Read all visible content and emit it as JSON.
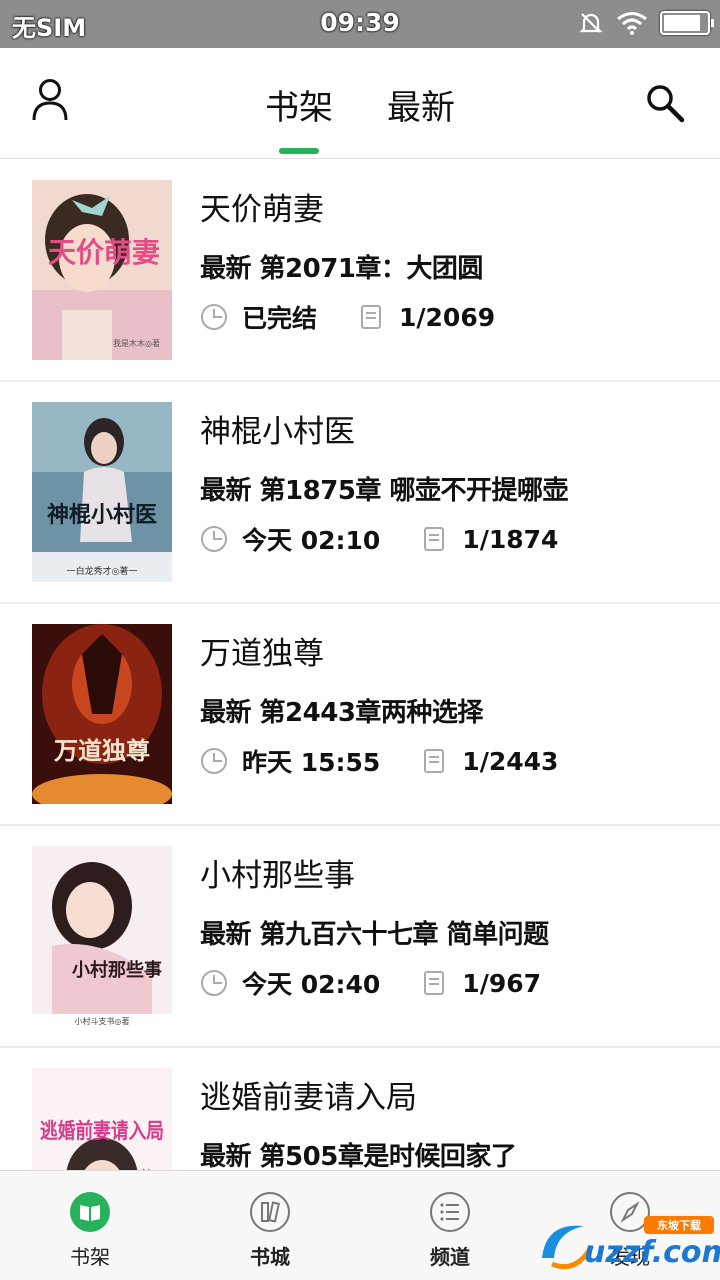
{
  "status_bar": {
    "carrier": "无SIM",
    "time": "09:39",
    "battery_level": 0.85
  },
  "header": {
    "tabs": [
      {
        "label": "书架",
        "active": true
      },
      {
        "label": "最新",
        "active": false
      }
    ],
    "accent_color": "#27b15a"
  },
  "books": [
    {
      "title": "天价萌妻",
      "latest": "最新 第2071章：大团圆",
      "status": "已完结",
      "progress": "1/2069"
    },
    {
      "title": "神棍小村医",
      "latest": "最新 第1875章 哪壶不开提哪壶",
      "status": "今天 02:10",
      "progress": "1/1874"
    },
    {
      "title": "万道独尊",
      "latest": "最新 第2443章两种选择",
      "status": "昨天 15:55",
      "progress": "1/2443"
    },
    {
      "title": "小村那些事",
      "latest": "最新 第九百六十七章  简单问题",
      "status": "今天 02:40",
      "progress": "1/967"
    },
    {
      "title": "逃婚前妻请入局",
      "latest": "最新 第505章是时候回家了",
      "status": "",
      "progress": ""
    }
  ],
  "covers": [
    {
      "text": "天价萌妻",
      "author": "我是木木◎著"
    },
    {
      "text": "神棍小村医",
      "author": "一白龙秀才◎著一"
    },
    {
      "text": "万道独尊",
      "author": ""
    },
    {
      "text": "小村那些事",
      "author": "小村斗支书◎著"
    },
    {
      "text": "逃婚前妻请入局",
      "author": "流二"
    }
  ],
  "bottom_nav": [
    {
      "label": "书架",
      "icon": "book-open-icon",
      "active": true
    },
    {
      "label": "书城",
      "icon": "books-icon",
      "active": false
    },
    {
      "label": "频道",
      "icon": "list-icon",
      "active": false
    },
    {
      "label": "发现",
      "icon": "compass-icon",
      "active": false
    }
  ],
  "watermark": {
    "text": "uzzf.com",
    "subtext": "东坡下载"
  }
}
